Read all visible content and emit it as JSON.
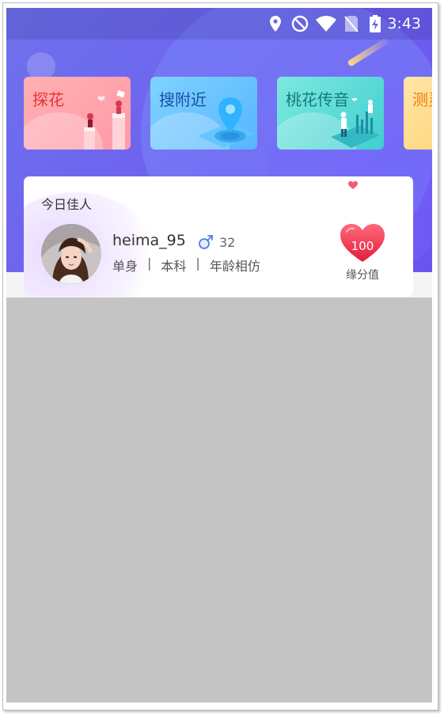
{
  "status_bar": {
    "time": "3:43",
    "icons": [
      "location-icon",
      "do-not-disturb-icon",
      "wifi-icon",
      "no-sim-icon",
      "battery-charging-icon"
    ]
  },
  "quick_actions": [
    {
      "label": "探花",
      "icon": "flower-illustration",
      "color": "#ff9aa8"
    },
    {
      "label": "搜附近",
      "icon": "map-pin-illustration",
      "color": "#59b4ff"
    },
    {
      "label": "桃花传音",
      "icon": "voice-illustration",
      "color": "#40cfcf"
    },
    {
      "label": "测灵",
      "icon": "test-illustration",
      "color": "#ffd57a"
    }
  ],
  "today_best": {
    "title": "今日佳人",
    "username": "heima_95",
    "gender_icon": "male-icon",
    "age": "32",
    "tags": [
      "单身",
      "本科",
      "年龄相仿"
    ],
    "tag_separator": "|",
    "match_score": "100",
    "match_label": "缘分值"
  },
  "colors": {
    "hero_gradient_start": "#6f73ec",
    "hero_gradient_end": "#6a55ee",
    "heart": "#e8334a",
    "background_below": "#c4c4c4"
  }
}
